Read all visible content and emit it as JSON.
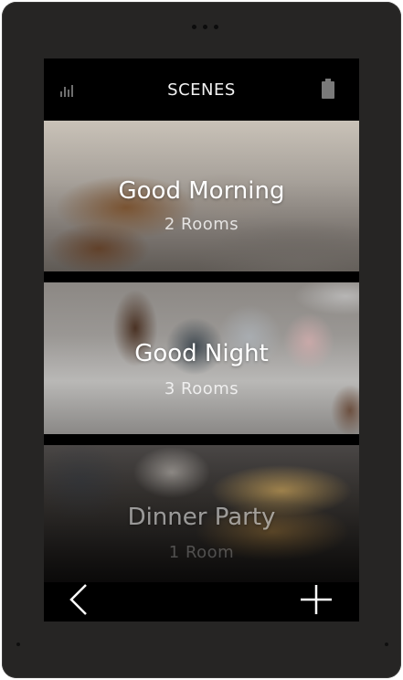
{
  "header": {
    "title": "SCENES",
    "left_icon": "signal-bars-icon",
    "right_icon": "battery-icon"
  },
  "scenes": [
    {
      "name": "Good Morning",
      "rooms": "2 Rooms"
    },
    {
      "name": "Good Night",
      "rooms": "3 Rooms"
    },
    {
      "name": "Dinner Party",
      "rooms": "1 Room"
    }
  ],
  "footer": {
    "back_icon": "chevron-left-icon",
    "add_icon": "plus-icon"
  },
  "colors": {
    "bezel": "#262524",
    "screen": "#000000",
    "text": "#ffffff"
  }
}
